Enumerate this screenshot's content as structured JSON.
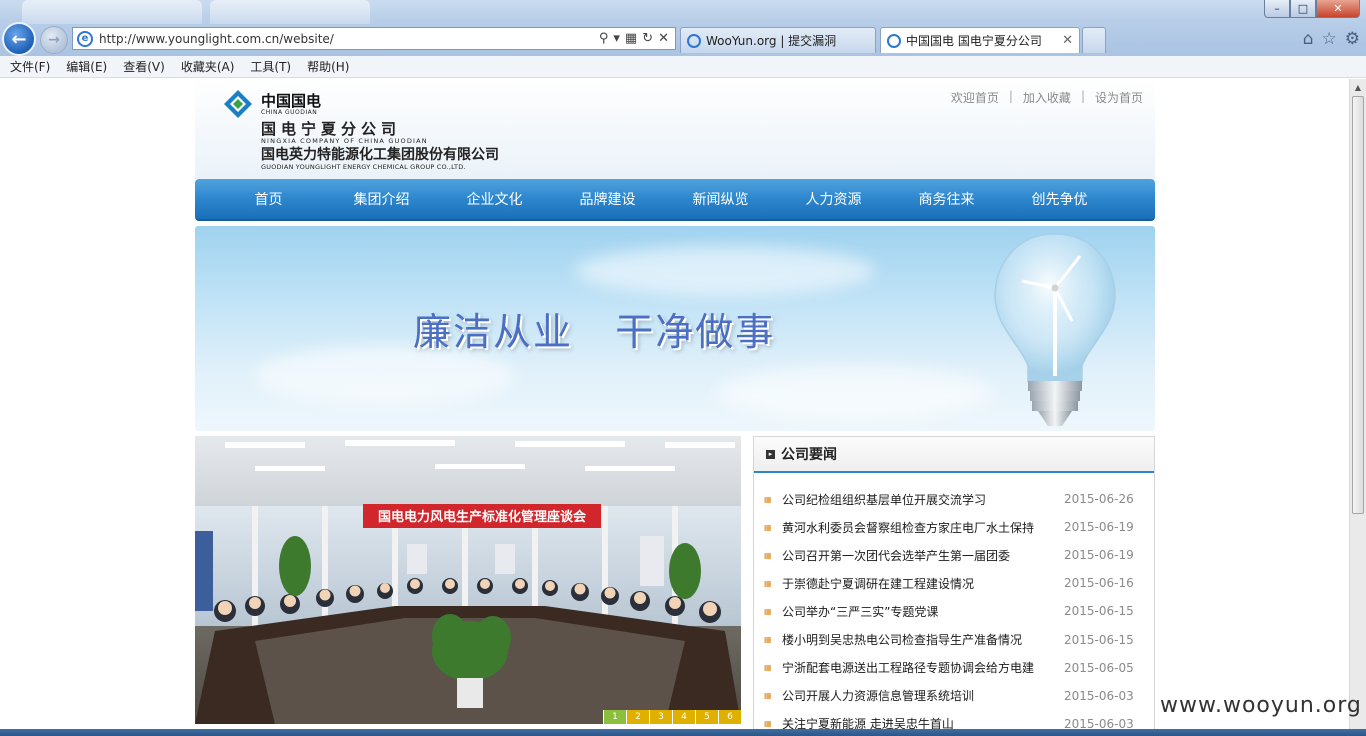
{
  "browser": {
    "url": "http://www.younglight.com.cn/website/",
    "tabs": [
      {
        "label": "WooYun.org | 提交漏洞"
      },
      {
        "label": "中国国电 国电宁夏分公司"
      }
    ],
    "menu": [
      "文件(F)",
      "编辑(E)",
      "查看(V)",
      "收藏夹(A)",
      "工具(T)",
      "帮助(H)"
    ]
  },
  "header": {
    "brand_cn": "中国国电",
    "brand_en": "CHINA GUODIAN",
    "company_cn": "国电宁夏分公司",
    "company_en": "NINGXIA COMPANY OF CHINA GUODIAN",
    "group_cn": "国电英力特能源化工集团股份有限公司",
    "group_en": "GUODIAN YOUNGLIGHT ENERGY CHEMICAL GROUP CO.,LTD.",
    "links": [
      "欢迎首页",
      "加入收藏",
      "设为首页"
    ],
    "link_separator": "|"
  },
  "nav": [
    "首页",
    "集团介绍",
    "企业文化",
    "品牌建设",
    "新闻纵览",
    "人力资源",
    "商务往来",
    "创先争优"
  ],
  "banner": {
    "slogan": "廉洁从业   干净做事"
  },
  "slider": {
    "meeting_banner": "国电电力风电生产标准化管理座谈会",
    "pages": [
      "1",
      "2",
      "3",
      "4",
      "5",
      "6"
    ],
    "active_page": "1"
  },
  "news": {
    "title": "公司要闻",
    "items": [
      {
        "headline": "公司纪检组组织基层单位开展交流学习",
        "date": "2015-06-26"
      },
      {
        "headline": "黄河水利委员会督察组检查方家庄电厂水土保持",
        "date": "2015-06-19"
      },
      {
        "headline": "公司召开第一次团代会选举产生第一届团委",
        "date": "2015-06-19"
      },
      {
        "headline": "于崇德赴宁夏调研在建工程建设情况",
        "date": "2015-06-16"
      },
      {
        "headline": "公司举办“三严三实”专题党课",
        "date": "2015-06-15"
      },
      {
        "headline": "楼小明到吴忠热电公司检查指导生产准备情况",
        "date": "2015-06-15"
      },
      {
        "headline": "宁浙配套电源送出工程路径专题协调会给方电建",
        "date": "2015-06-05"
      },
      {
        "headline": "公司开展人力资源信息管理系统培训",
        "date": "2015-06-03"
      },
      {
        "headline": "关注宁夏新能源 走进吴忠牛首山",
        "date": "2015-06-03"
      }
    ]
  },
  "watermark": "www.wooyun.org"
}
